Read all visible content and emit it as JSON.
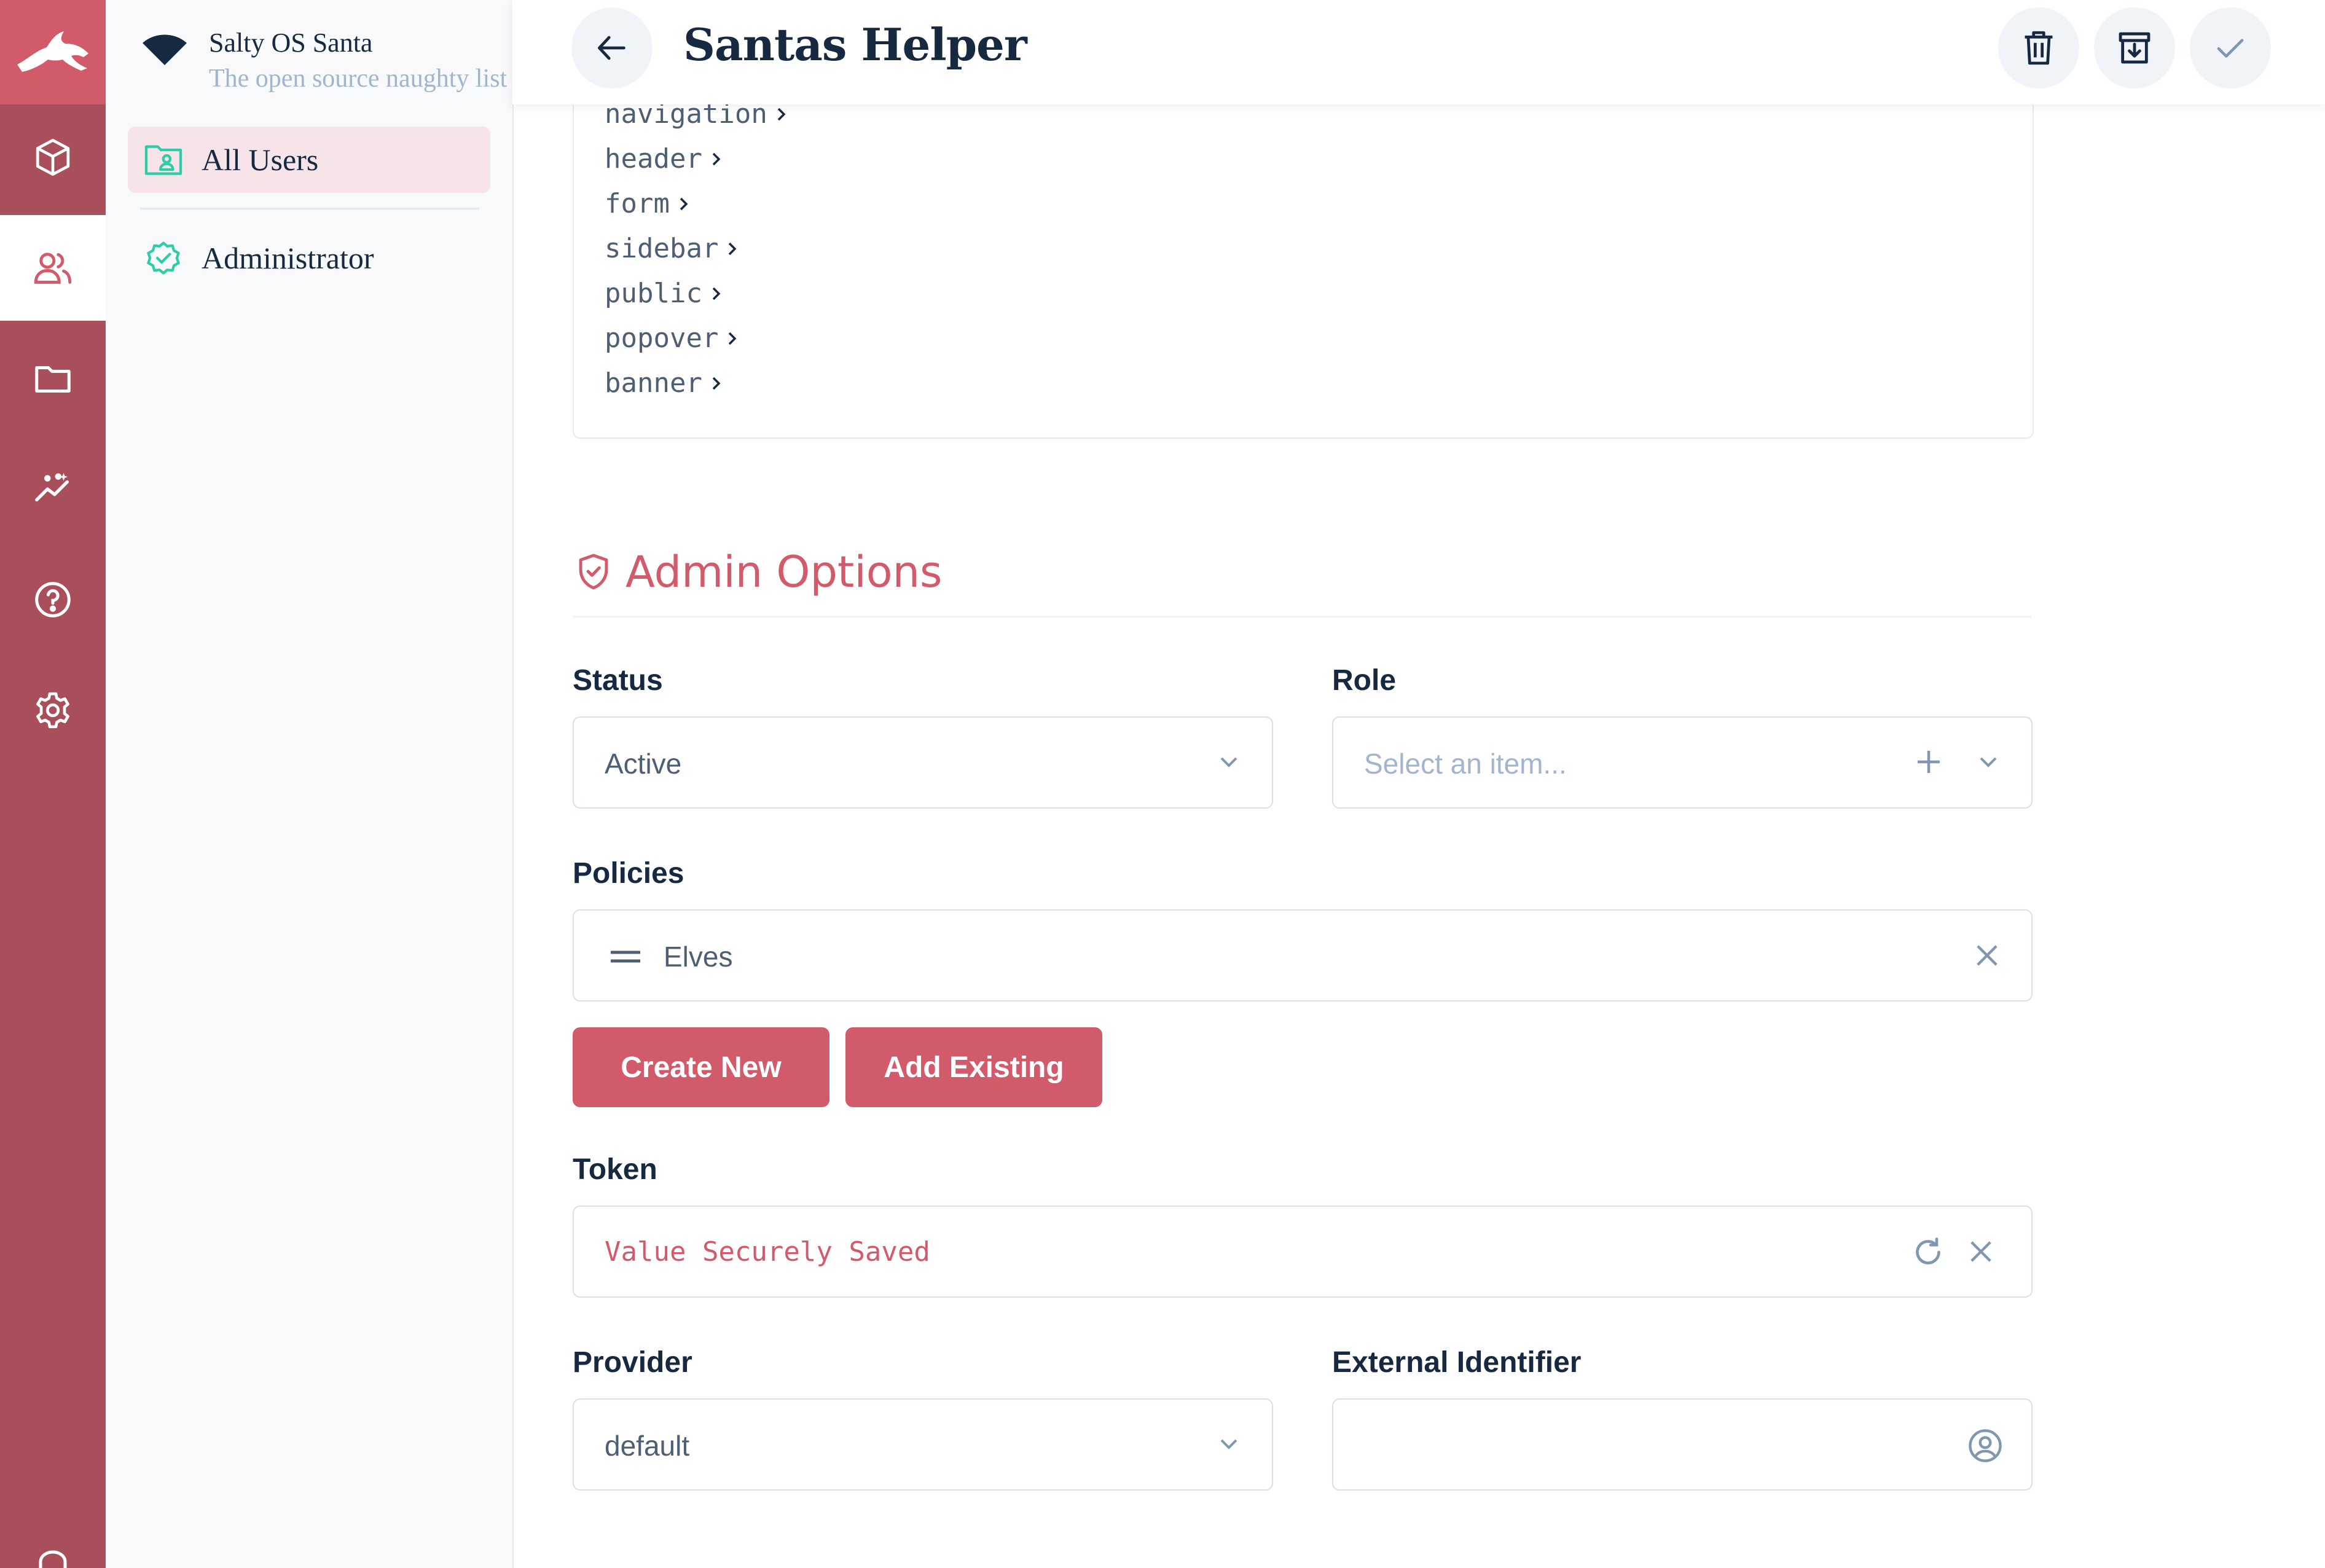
{
  "colors": {
    "primary": "#d15b6b",
    "module_bar": "#a94f5b",
    "nav_active": "#f6e4e8",
    "success": "#2ecda7",
    "text": "#172940",
    "text_subdued": "#a2b5cd"
  },
  "project": {
    "name": "Salty OS Santa",
    "descriptor": "The open source naughty list"
  },
  "module_bar": {
    "logo_icon": "rabbit-logo-icon",
    "modules": [
      {
        "icon": "content-cube-icon"
      },
      {
        "icon": "users-icon",
        "active": true
      },
      {
        "icon": "folder-icon"
      },
      {
        "icon": "insights-icon"
      },
      {
        "icon": "help-icon"
      },
      {
        "icon": "settings-icon"
      }
    ]
  },
  "nav": {
    "items": [
      {
        "label": "All Users",
        "icon": "folder-user-icon",
        "active": true
      },
      {
        "label": "Administrator",
        "icon": "verified-badge-icon"
      }
    ]
  },
  "header": {
    "title": "Santas Helper",
    "actions": [
      "delete-icon",
      "archive-icon",
      "save-check-icon"
    ]
  },
  "permissions_tree": [
    "navigation",
    "header",
    "form",
    "sidebar",
    "public",
    "popover",
    "banner"
  ],
  "admin_options": {
    "title": "Admin Options",
    "status": {
      "label": "Status",
      "value": "Active"
    },
    "role": {
      "label": "Role",
      "placeholder": "Select an item..."
    },
    "policies": {
      "label": "Policies",
      "items": [
        "Elves"
      ]
    },
    "buttons": {
      "create_new": "Create New",
      "add_existing": "Add Existing"
    },
    "token": {
      "label": "Token",
      "value": "Value Securely Saved"
    },
    "provider": {
      "label": "Provider",
      "value": "default"
    },
    "external_identifier": {
      "label": "External Identifier",
      "value": ""
    }
  }
}
